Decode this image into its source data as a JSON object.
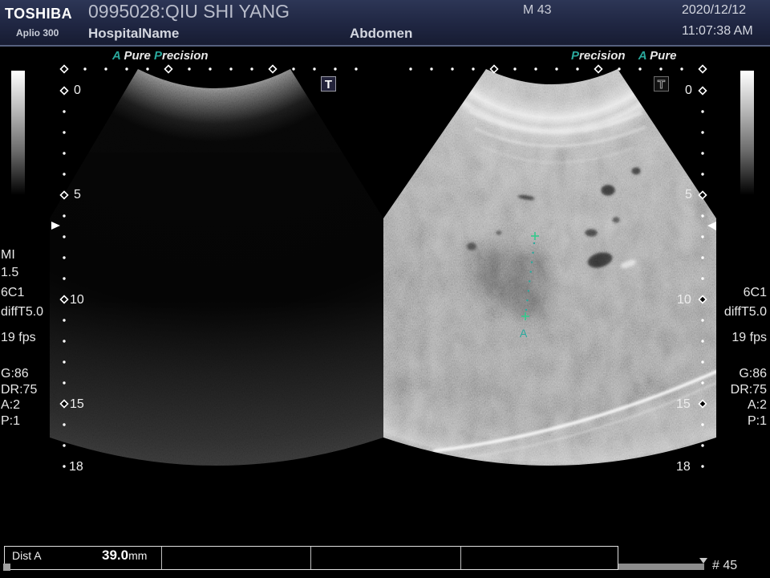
{
  "header": {
    "brand": "TOSHIBA",
    "model": "Aplio 300",
    "patient": "0995028:QIU SHI YANG",
    "hospital": "HospitalName",
    "exam": "Abdomen",
    "patient_info": "M 43",
    "date": "2020/12/12",
    "time": "11:07:38 AM"
  },
  "mode_labels": {
    "a": "A",
    "pure": "Pure",
    "precision": "Precision"
  },
  "transducer_icon": {
    "letter": "T"
  },
  "depth_scale": {
    "labels": [
      "0",
      "5",
      "10",
      "15",
      "18"
    ]
  },
  "left_params": [
    "MI",
    "1.5",
    "6C1",
    "diffT5.0",
    "19 fps",
    "G:86",
    "DR:75",
    "A:2",
    "P:1"
  ],
  "right_params": [
    "6C1",
    "diffT5.0",
    "19 fps",
    "G:86",
    "DR:75",
    "A:2",
    "P:1"
  ],
  "measurement": {
    "marker": "A",
    "label": "Dist A",
    "value": "39.0",
    "unit": "mm"
  },
  "cine": {
    "frame": "# 45"
  },
  "colors": {
    "header_bg": "#1f2642",
    "accent": "#2aa89c",
    "caliper": "#33c98c",
    "overlay_text": "#e8e8e8",
    "background": "#000000"
  },
  "icons": [
    "gray-scale-bar",
    "transducer-t-icon",
    "focus-marker-icon",
    "caliper-plus-icon",
    "depth-marker-diamond"
  ]
}
